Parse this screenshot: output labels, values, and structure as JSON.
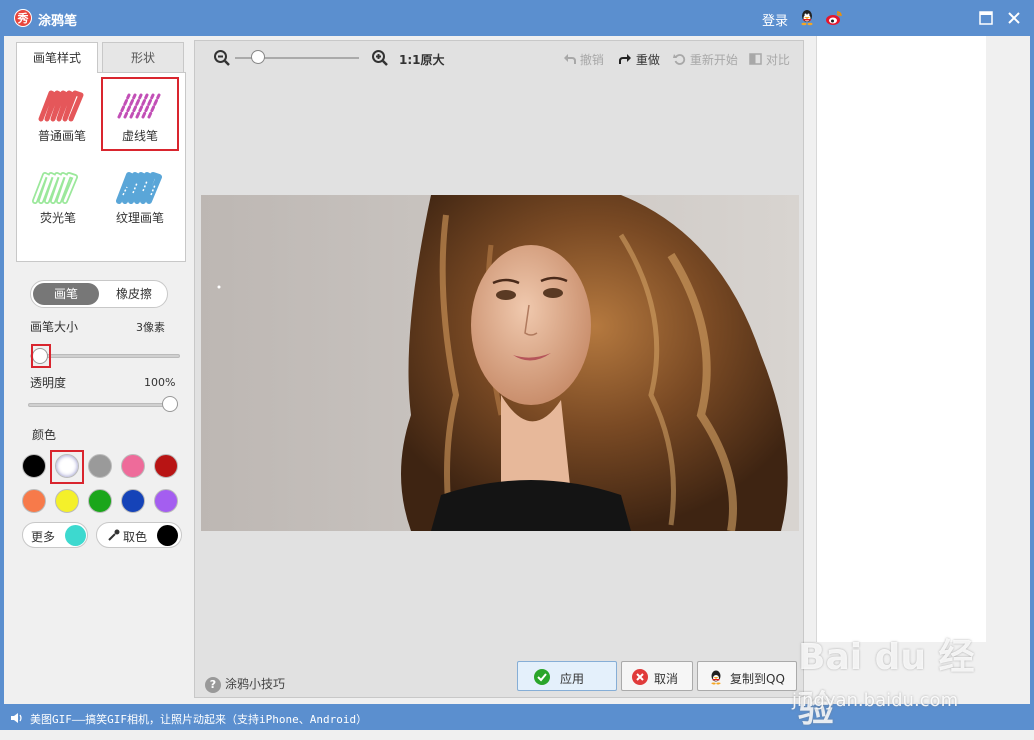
{
  "window": {
    "title": "涂鸦笔",
    "logo_glyph": "秀",
    "login_label": "登录"
  },
  "left_panel": {
    "tabs": [
      {
        "label": "画笔样式",
        "active": true
      },
      {
        "label": "形状",
        "active": false
      }
    ],
    "brushes": [
      {
        "label": "普通画笔",
        "color": "#e5575a"
      },
      {
        "label": "虚线笔",
        "color": "#c24fb6",
        "selected": true
      },
      {
        "label": "荧光笔",
        "color": "#7fdc7f"
      },
      {
        "label": "纹理画笔",
        "color": "#5aa6d8"
      }
    ],
    "mode": {
      "pen_label": "画笔",
      "eraser_label": "橡皮擦",
      "active": "pen"
    },
    "brush_size": {
      "label": "画笔大小",
      "value": "3像素",
      "level": 0.0
    },
    "opacity": {
      "label": "透明度",
      "value": "100%",
      "level": 1.0
    },
    "color_section_label": "颜色",
    "swatches": [
      {
        "name": "black",
        "color": "#000000"
      },
      {
        "name": "white",
        "color": "#ffffff",
        "selected": true
      },
      {
        "name": "gray",
        "color": "#9a9a9a"
      },
      {
        "name": "pink",
        "color": "#ee6b9a"
      },
      {
        "name": "dark-red",
        "color": "#b81414"
      },
      {
        "name": "orange",
        "color": "#f77a4a"
      },
      {
        "name": "yellow",
        "color": "#f4f02a"
      },
      {
        "name": "green",
        "color": "#1aa61a"
      },
      {
        "name": "blue",
        "color": "#1543b8"
      },
      {
        "name": "purple",
        "color": "#a45ef0"
      }
    ],
    "more_label": "更多",
    "more_color": "#3dd9cf",
    "pick_label": "取色",
    "pick_color": "#000000"
  },
  "toolbar": {
    "zoom_original_label": "1:1原大",
    "undo_label": "撤销",
    "redo_label": "重做",
    "restart_label": "重新开始",
    "compare_label": "对比"
  },
  "footer": {
    "tips_label": "涂鸦小技巧",
    "apply_label": "应用",
    "cancel_label": "取消",
    "copy_label": "复制到QQ"
  },
  "statusbar": {
    "text": "美图GIF——搞笑GIF相机，让照片动起来（支持iPhone、Android）"
  },
  "watermark": {
    "main": "Bai du 经验",
    "sub": "jingyan.baidu.com"
  }
}
